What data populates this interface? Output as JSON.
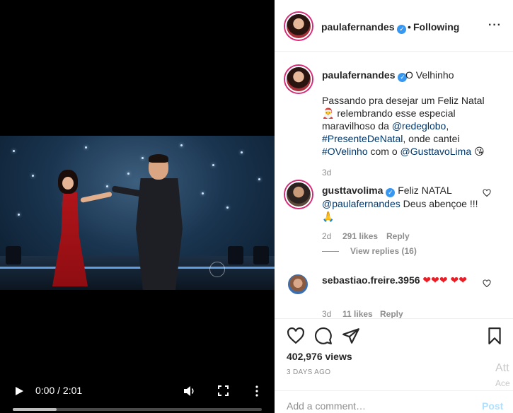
{
  "video": {
    "time_label": "0:00 / 2:01",
    "progress_fraction": 0.0,
    "icons": [
      "play-icon",
      "volume-icon",
      "fullscreen-icon",
      "more-vertical-icon"
    ]
  },
  "header": {
    "username": "paulafernandes",
    "dot": "•",
    "following_label": "Following",
    "more_label": "···"
  },
  "caption": {
    "username": "paulafernandes",
    "title": "O Velhinho",
    "text_part1": "Passando pra desejar um Feliz Natal 🎅 relembrando esse especial maravilhoso da ",
    "link1": "@redeglobo",
    "text_part2": ", ",
    "link2": "#PresenteDeNatal",
    "text_part3": ", onde cantei ",
    "link3": "#OVelinho",
    "text_part4": "  com o ",
    "link4": "@GusttavoLima",
    "text_part5": " 😘",
    "time": "3d"
  },
  "comments": [
    {
      "username": "gusttavolima",
      "text_prefix": " Feliz NATAL ",
      "mention": "@paulafernandes",
      "text_suffix": " Deus abençoe !!! 🙏",
      "time": "2d",
      "likes": "291 likes",
      "reply_label": "Reply",
      "view_replies": "View replies (16)"
    },
    {
      "username": "sebastiao.freire.3956",
      "text": " ❤❤❤ ❤❤",
      "time": "3d",
      "likes": "11 likes",
      "reply_label": "Reply"
    }
  ],
  "actions": {
    "views": "402,976 views",
    "time_ago": "3 DAYS AGO",
    "icons": [
      "heart-icon",
      "comment-icon",
      "share-icon",
      "bookmark-icon"
    ]
  },
  "comment_input": {
    "placeholder": "Add a comment…",
    "post_label": "Post"
  },
  "overlay": {
    "at_text": "Att",
    "ace_text": "Ace"
  },
  "colors": {
    "verified": "#3897f0",
    "link": "#00376b",
    "post_disabled": "#b2dffc",
    "heart_emoji": "#ed1c24"
  }
}
